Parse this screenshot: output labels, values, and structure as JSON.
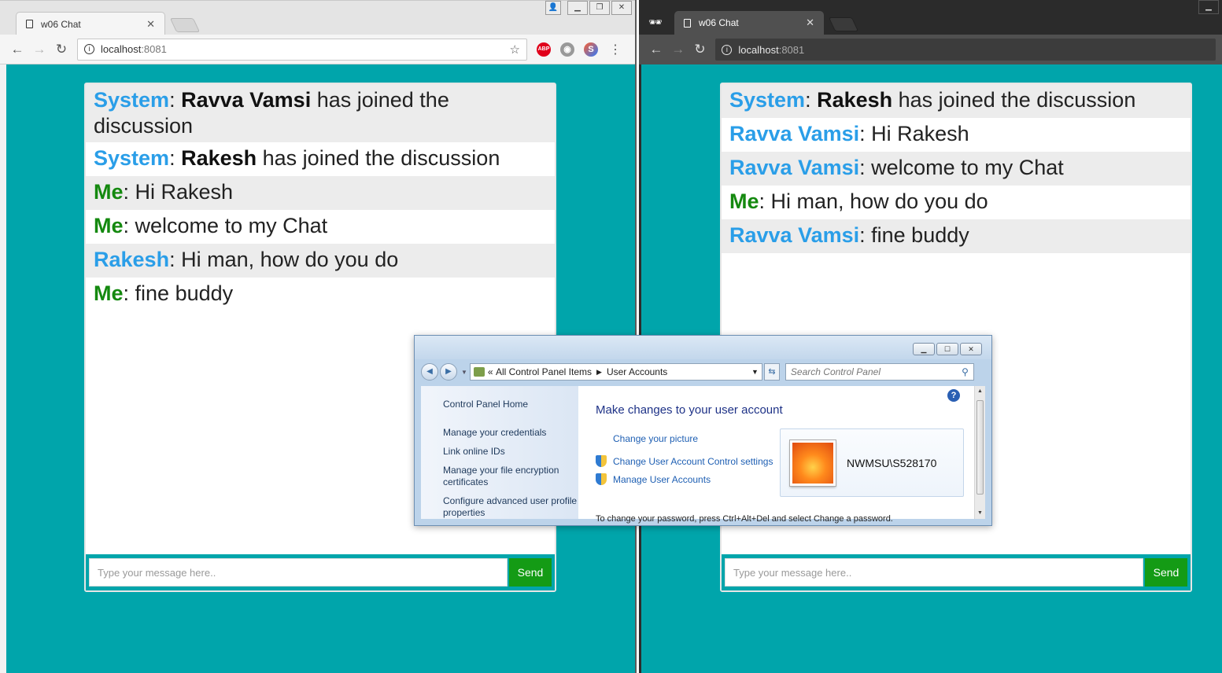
{
  "left_browser": {
    "tab_title": "w06 Chat",
    "url_host": "localhost",
    "url_port": ":8081",
    "extensions": [
      "ABP",
      "globe",
      "S"
    ],
    "messages": [
      {
        "sender": "System",
        "sender_role": "system",
        "who": "Ravva Vamsi",
        "text": " has joined the discussion"
      },
      {
        "sender": "System",
        "sender_role": "system",
        "who": "Rakesh",
        "text": " has joined the discussion"
      },
      {
        "sender": "Me",
        "sender_role": "me",
        "who": "",
        "text": "Hi Rakesh"
      },
      {
        "sender": "Me",
        "sender_role": "me",
        "who": "",
        "text": "welcome to my Chat"
      },
      {
        "sender": "Rakesh",
        "sender_role": "other",
        "who": "",
        "text": "Hi man, how do you do"
      },
      {
        "sender": "Me",
        "sender_role": "me",
        "who": "",
        "text": "fine buddy"
      }
    ],
    "input_placeholder": "Type your message here..",
    "send_label": "Send"
  },
  "right_browser": {
    "tab_title": "w06 Chat",
    "url_host": "localhost",
    "url_port": ":8081",
    "incognito": true,
    "messages": [
      {
        "sender": "System",
        "sender_role": "system",
        "who": "Rakesh",
        "text": " has joined the discussion"
      },
      {
        "sender": "Ravva Vamsi",
        "sender_role": "other",
        "who": "",
        "text": "Hi Rakesh"
      },
      {
        "sender": "Ravva Vamsi",
        "sender_role": "other",
        "who": "",
        "text": "welcome to my Chat"
      },
      {
        "sender": "Me",
        "sender_role": "me",
        "who": "",
        "text": "Hi man, how do you do"
      },
      {
        "sender": "Ravva Vamsi",
        "sender_role": "other",
        "who": "",
        "text": "fine buddy"
      }
    ],
    "input_placeholder": "Type your message here..",
    "send_label": "Send"
  },
  "control_panel": {
    "breadcrumb_prefix": "«",
    "breadcrumb": [
      "All Control Panel Items",
      "User Accounts"
    ],
    "search_placeholder": "Search Control Panel",
    "sidebar_links": [
      "Control Panel Home",
      "Manage your credentials",
      "Link online IDs",
      "Manage your file encryption certificates",
      "Configure advanced user profile properties"
    ],
    "heading": "Make changes to your user account",
    "tasks": [
      {
        "label": "Change your picture",
        "shield": false
      },
      {
        "label": "Change User Account Control settings",
        "shield": true
      },
      {
        "label": "Manage User Accounts",
        "shield": true
      }
    ],
    "username": "NWMSU\\S528170",
    "cutoff_text": "To change your password, press Ctrl+Alt+Del and select Change a password."
  },
  "colors": {
    "page_bg": "#00a5ab",
    "system_sender": "#2a9ee8",
    "me_sender": "#14890f",
    "other_sender": "#2a9ee8",
    "send_button": "#149b15"
  }
}
